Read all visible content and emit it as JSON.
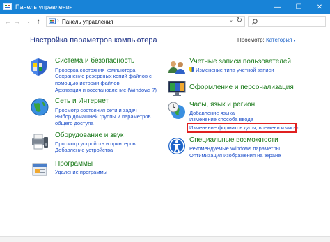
{
  "window": {
    "title": "Панель управления",
    "minimize_glyph": "—",
    "maximize_glyph": "☐",
    "close_glyph": "✕"
  },
  "nav": {
    "back_glyph": "←",
    "forward_glyph": "→",
    "history_glyph": "⌄",
    "up_glyph": "↑"
  },
  "address": {
    "separator": "›",
    "path": "Панель управления",
    "dropdown_glyph": "⌄",
    "refresh_glyph": "↻"
  },
  "main": {
    "heading": "Настройка параметров компьютера",
    "view_by_label": "Просмотр:",
    "view_by_value": "Категория",
    "view_by_caret": "▾"
  },
  "categories_left": [
    {
      "title": "Система и безопасность",
      "icon": "shield-system-icon",
      "links": [
        "Проверка состояния компьютера",
        "Сохранение резервных копий файлов с помощью истории файлов",
        "Архивация и восстановление (Windows 7)"
      ]
    },
    {
      "title": "Сеть и Интернет",
      "icon": "network-globe-icon",
      "links": [
        "Просмотр состояния сети и задач",
        "Выбор домашней группы и параметров общего доступа"
      ]
    },
    {
      "title": "Оборудование и звук",
      "icon": "printer-speaker-icon",
      "links": [
        "Просмотр устройств и принтеров",
        "Добавление устройства"
      ]
    },
    {
      "title": "Программы",
      "icon": "programs-icon",
      "links": [
        "Удаление программы"
      ]
    }
  ],
  "categories_right": [
    {
      "title": "Учетные записи пользователей",
      "icon": "users-icon",
      "links": [
        "Изменение типа учетной записи"
      ]
    },
    {
      "title": "Оформление и персонализация",
      "icon": "personalization-icon",
      "links": []
    },
    {
      "title": "Часы, язык и регион",
      "icon": "clock-globe-icon",
      "links": [
        "Добавление языка",
        "Изменение способа ввода",
        "Изменение форматов даты, времени и чисел"
      ]
    },
    {
      "title": "Специальные возможности",
      "icon": "accessibility-icon",
      "links": [
        "Рекомендуемые Windows параметры",
        "Оптимизация изображения на экране"
      ]
    }
  ],
  "colors": {
    "titlebar": "#1883d7",
    "heading": "#1e3287",
    "category_title": "#1a7a1a",
    "link": "#1f50c9",
    "highlight": "#e02020"
  }
}
